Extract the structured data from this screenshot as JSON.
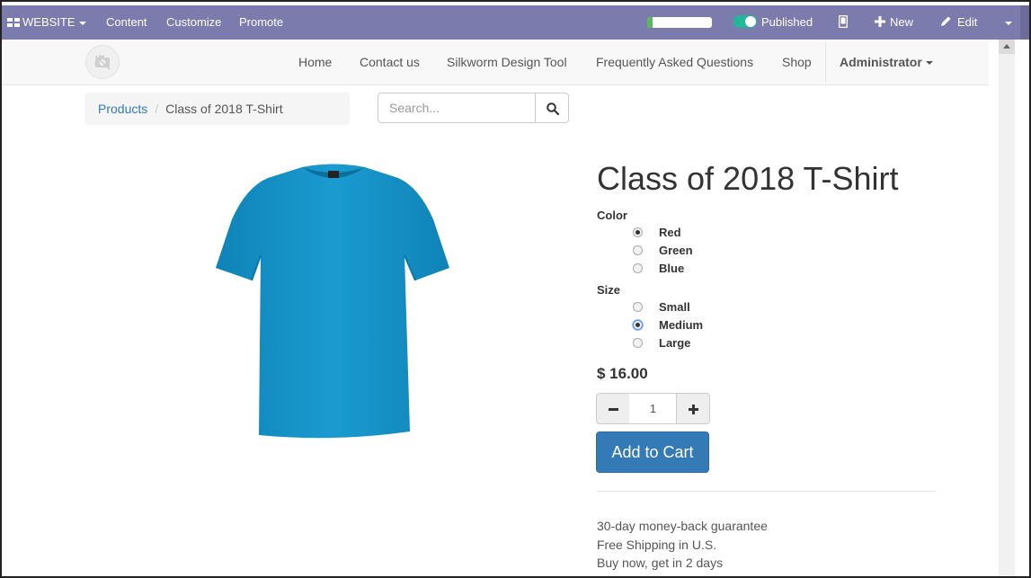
{
  "admin_bar": {
    "website_menu": "WEBSITE",
    "content": "Content",
    "customize": "Customize",
    "promote": "Promote",
    "progress_fraction": 0.08,
    "published": "Published",
    "new": "New",
    "edit": "Edit"
  },
  "navbar": {
    "items": [
      "Home",
      "Contact us",
      "Silkworm Design Tool",
      "Frequently Asked Questions",
      "Shop"
    ],
    "user": "Administrator"
  },
  "breadcrumb": {
    "parent": "Products",
    "current": "Class of 2018 T-Shirt"
  },
  "search": {
    "placeholder": "Search..."
  },
  "product": {
    "title": "Class of 2018 T-Shirt",
    "image_color": "#1a95c9",
    "attributes": [
      {
        "label": "Color",
        "options": [
          "Red",
          "Green",
          "Blue"
        ],
        "selected": "Red"
      },
      {
        "label": "Size",
        "options": [
          "Small",
          "Medium",
          "Large"
        ],
        "selected": "Medium"
      }
    ],
    "price": "$ 16.00",
    "quantity": "1",
    "add_to_cart": "Add to Cart",
    "info": [
      "30-day money-back guarantee",
      "Free Shipping in U.S.",
      "Buy now, get in 2 days"
    ]
  },
  "colors": {
    "admin_bar": "#7c7bad",
    "primary": "#337ab7",
    "toggle_on": "#21b799"
  }
}
